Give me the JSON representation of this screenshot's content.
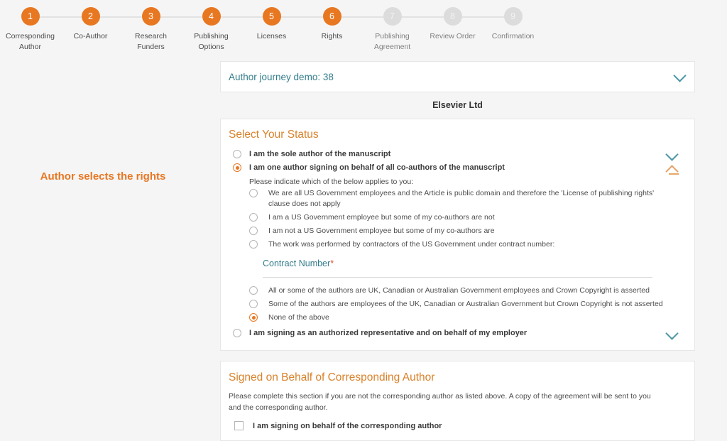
{
  "colors": {
    "accent_orange": "#e87722",
    "teal_link": "#337d8c",
    "section_title": "#d9822b",
    "required_star": "#e24a33",
    "page_background": "#f5f5f5",
    "panel_background": "#ffffff"
  },
  "stepper": {
    "steps": [
      {
        "number": "1",
        "label": "Corresponding\nAuthor",
        "state": "active"
      },
      {
        "number": "2",
        "label": "Co-Author",
        "state": "active"
      },
      {
        "number": "3",
        "label": "Research\nFunders",
        "state": "active"
      },
      {
        "number": "4",
        "label": "Publishing\nOptions",
        "state": "active"
      },
      {
        "number": "5",
        "label": "Licenses",
        "state": "active"
      },
      {
        "number": "6",
        "label": "Rights",
        "state": "active"
      },
      {
        "number": "7",
        "label": "Publishing\nAgreement",
        "state": "inactive"
      },
      {
        "number": "8",
        "label": "Review Order",
        "state": "inactive"
      },
      {
        "number": "9",
        "label": "Confirmation",
        "state": "inactive"
      }
    ]
  },
  "annotation": {
    "text": "Author selects the rights"
  },
  "journey": {
    "title": "Author journey demo: 38",
    "toggle_icon": "chevron-down-icon"
  },
  "publisher": {
    "name": "Elsevier Ltd"
  },
  "status_section": {
    "title": "Select Your Status",
    "options": [
      {
        "label": "I am the sole author of the manuscript",
        "selected": false,
        "toggle_icon": "chevron-down-icon"
      },
      {
        "label": "I am one author signing on behalf of all co-authors of the manuscript",
        "selected": true,
        "toggle_icon": "chevron-up-icon"
      }
    ],
    "sub_intro": "Please indicate which of the below applies to you:",
    "sub_options": [
      {
        "label": "We are all US Government employees and the Article is public domain and therefore the 'License of publishing rights' clause does not apply",
        "selected": false
      },
      {
        "label": "I am a US Government employee but some of my co-authors are not",
        "selected": false
      },
      {
        "label": "I am not a US Government employee but some of my co-authors are",
        "selected": false
      },
      {
        "label": "The work was performed by contractors of the US Government under contract number:",
        "selected": false
      }
    ],
    "contract_field": {
      "label": "Contract Number",
      "required_marker": "*",
      "value": "",
      "placeholder": ""
    },
    "crown_options": [
      {
        "label": "All or some of the authors are UK, Canadian or Australian Government employees and Crown Copyright is asserted",
        "selected": false
      },
      {
        "label": "Some of the authors are employees of the UK, Canadian or Australian Government but Crown Copyright is not asserted",
        "selected": false
      },
      {
        "label": "None of the above",
        "selected": true
      }
    ],
    "last_option": {
      "label": "I am signing as an authorized representative and on behalf of my employer",
      "selected": false,
      "toggle_icon": "chevron-down-icon"
    }
  },
  "signed_section": {
    "title": "Signed on Behalf of Corresponding Author",
    "description": "Please complete this section if you are not the corresponding author as listed above. A copy of the agreement will be sent to you and the corresponding author.",
    "checkbox_label": "I am signing on behalf of the corresponding author",
    "checkbox_checked": false
  }
}
